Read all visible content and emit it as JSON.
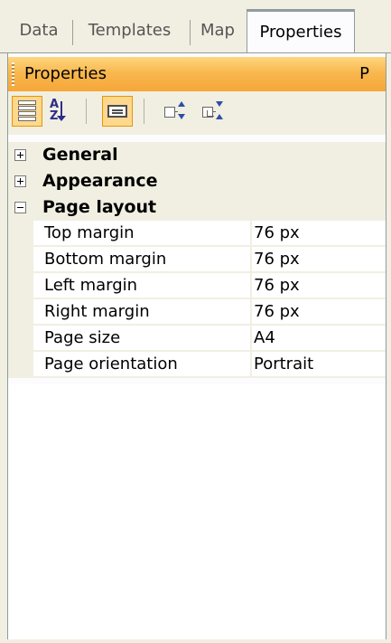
{
  "tabs": [
    {
      "label": "Data"
    },
    {
      "label": "Templates"
    },
    {
      "label": "Map"
    },
    {
      "label": "Properties",
      "active": true
    }
  ],
  "panel": {
    "title": "Properties",
    "pin_icon": "pin-icon",
    "pin_glyph": "Ρ"
  },
  "toolbar": {
    "buttons": [
      {
        "name": "categorized-view-button",
        "icon": "categorized-icon",
        "active": true
      },
      {
        "name": "alphabetical-sort-button",
        "icon": "sort-az-icon",
        "active": false
      },
      {
        "name": "property-pages-button",
        "icon": "property-pages-icon",
        "active": true
      },
      {
        "name": "expand-all-button",
        "icon": "expand-all-icon",
        "active": false
      },
      {
        "name": "collapse-all-button",
        "icon": "collapse-all-icon",
        "active": false
      }
    ]
  },
  "grid": {
    "categories": [
      {
        "label": "General",
        "expanded": false
      },
      {
        "label": "Appearance",
        "expanded": false
      },
      {
        "label": "Page layout",
        "expanded": true
      }
    ],
    "properties": [
      {
        "name": "Top margin",
        "value": "76 px"
      },
      {
        "name": "Bottom margin",
        "value": "76 px"
      },
      {
        "name": "Left margin",
        "value": "76 px"
      },
      {
        "name": "Right margin",
        "value": "76 px"
      },
      {
        "name": "Page size",
        "value": "A4"
      },
      {
        "name": "Page orientation",
        "value": "Portrait"
      }
    ]
  },
  "colors": {
    "title_bar": "#f6a638",
    "active_button": "#ffd890",
    "background": "#f1efe2"
  }
}
